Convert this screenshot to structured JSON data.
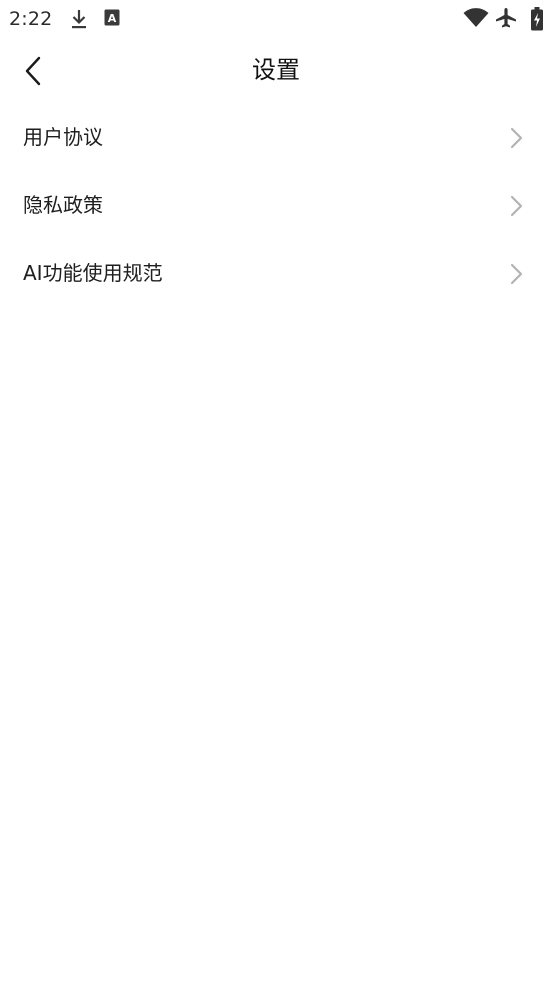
{
  "status_bar": {
    "time": "2:22",
    "badge_letter": "A",
    "icons": [
      "download-icon",
      "a-notification-icon",
      "wifi-icon",
      "airplane-mode-icon",
      "battery-charging-icon"
    ]
  },
  "header": {
    "title": "设置",
    "back_icon": "chevron-left-icon"
  },
  "menu": {
    "items": [
      {
        "label": "用户协议",
        "icon": "chevron-right-icon"
      },
      {
        "label": "隐私政策",
        "icon": "chevron-right-icon"
      },
      {
        "label": "AI功能使用规范",
        "icon": "chevron-right-icon"
      }
    ]
  },
  "colors": {
    "background": "#ffffff",
    "text": "#1e1e1e",
    "chevron": "#b3b3b3",
    "status": "#2b2b2b"
  }
}
